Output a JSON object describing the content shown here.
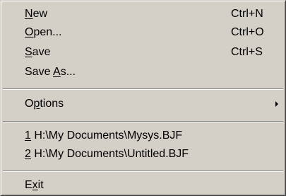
{
  "menu": {
    "new": {
      "pre": "",
      "key": "N",
      "post": "ew",
      "shortcut": "Ctrl+N"
    },
    "open": {
      "pre": "",
      "key": "O",
      "post": "pen...",
      "shortcut": "Ctrl+O"
    },
    "save": {
      "pre": "",
      "key": "S",
      "post": "ave",
      "shortcut": "Ctrl+S"
    },
    "save_as": {
      "pre": "Save ",
      "key": "A",
      "post": "s..."
    },
    "options": {
      "pre": "O",
      "key": "p",
      "post": "tions",
      "submenu_icon": "submenu-arrow-icon"
    },
    "recent": [
      {
        "pre": "",
        "key": "1",
        "post": " H:\\My Documents\\Mysys.BJF"
      },
      {
        "pre": "",
        "key": "2",
        "post": " H:\\My Documents\\Untitled.BJF"
      }
    ],
    "exit": {
      "pre": "E",
      "key": "x",
      "post": "it"
    }
  }
}
